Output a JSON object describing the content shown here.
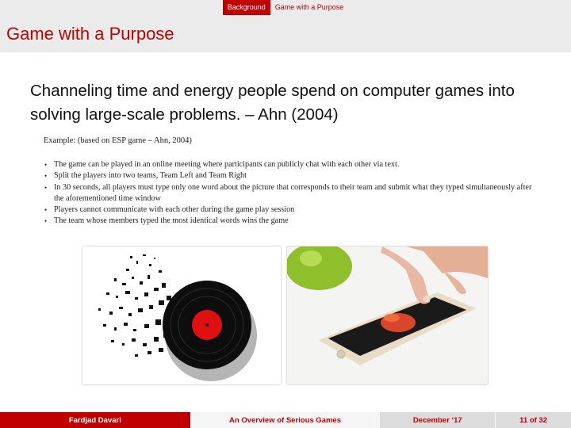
{
  "nav": {
    "section": "Background",
    "subsection": "Game with a Purpose"
  },
  "slide": {
    "title": "Game with a Purpose",
    "headline": "Channeling time and energy people spend on computer games into solving large-scale problems. – Ahn (2004)",
    "example_label": "Example: (based on ESP game – Ahn, 2004)",
    "bullets": [
      "The game can be played in an online meeting where participants can publicly chat with each other via text.",
      "Split the players into two teams, Team Left and Team Right",
      "In 30 seconds, all players must type only one word about the picture that corresponds to their team and submit what they typed simultaneously after the aforementioned time window",
      "Players cannot communicate with each other during the game play session",
      "The team whose members typed the most identical words wins the game"
    ],
    "images": {
      "left": "vinyl-record-disintegrating-image",
      "right": "hand-touching-smartphone-image"
    }
  },
  "footer": {
    "author": "Fardjad Davari",
    "title": "An Overview of Serious Games",
    "date": "December ‘17",
    "page": "11 of 32"
  },
  "colors": {
    "accent": "#c00000",
    "bar": "#ebebeb"
  }
}
